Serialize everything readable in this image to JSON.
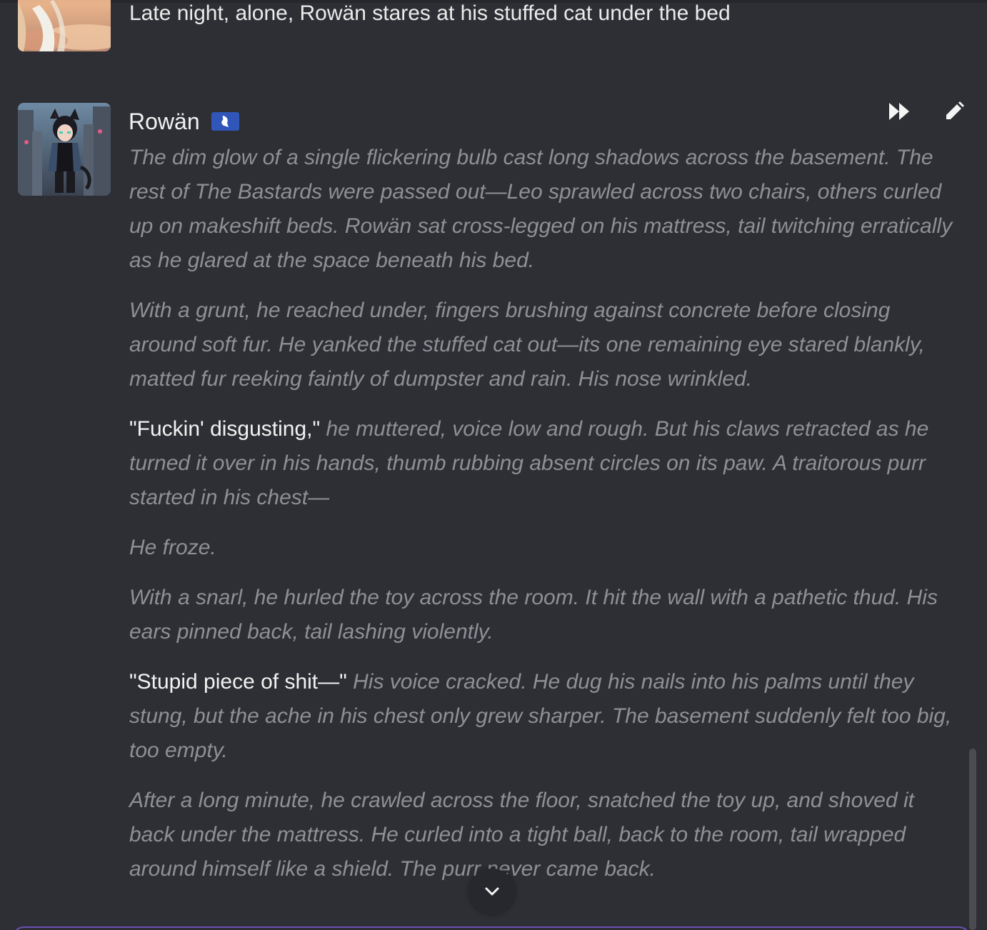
{
  "previous_message": {
    "text": "Late night, alone, Rowän stares at his stuffed cat under the bed",
    "avatar_icon": "user-avatar-image"
  },
  "message": {
    "character_name": "Rowän",
    "badge_icon": "character-badge-icon",
    "avatar_icon": "character-avatar-image",
    "actions": {
      "continue_icon": "fast-forward-icon",
      "edit_icon": "pencil-icon"
    },
    "paragraphs": [
      {
        "speech": "",
        "narration": "The dim glow of a single flickering bulb cast long shadows across the basement. The rest of The Bastards were passed out—Leo sprawled across two chairs, others curled up on makeshift beds. Rowän sat cross-legged on his mattress, tail twitching erratically as he glared at the space beneath his bed."
      },
      {
        "speech": "",
        "narration": "With a grunt, he reached under, fingers brushing against concrete before closing around soft fur. He yanked the stuffed cat out—its one remaining eye stared blankly, matted fur reeking faintly of dumpster and rain. His nose wrinkled."
      },
      {
        "speech": "\"Fuckin' disgusting,\"",
        "narration": " he muttered, voice low and rough. But his claws retracted as he turned it over in his hands, thumb rubbing absent circles on its paw. A traitorous purr started in his chest—"
      },
      {
        "speech": "",
        "narration": "He froze."
      },
      {
        "speech": "",
        "narration": "With a snarl, he hurled the toy across the room. It hit the wall with a pathetic thud. His ears pinned back, tail lashing violently."
      },
      {
        "speech": "\"Stupid piece of shit—\"",
        "narration": " His voice cracked. He dug his nails into his palms until they stung, but the ache in his chest only grew sharper. The basement suddenly felt too big, too empty."
      },
      {
        "speech": "",
        "narration": "After a long minute, he crawled across the floor, snatched the toy up, and shoved it back under the mattress. He curled into a tight ball, back to the room, tail wrapped around himself like a shield. The purr never came back."
      }
    ]
  },
  "scroll_down_icon": "chevron-down-icon",
  "colors": {
    "background": "#2e2f35",
    "narration": "#8f9096",
    "speech": "#f2f2f2",
    "badge": "#2f56b8",
    "input_border": "#6b4fb3"
  }
}
